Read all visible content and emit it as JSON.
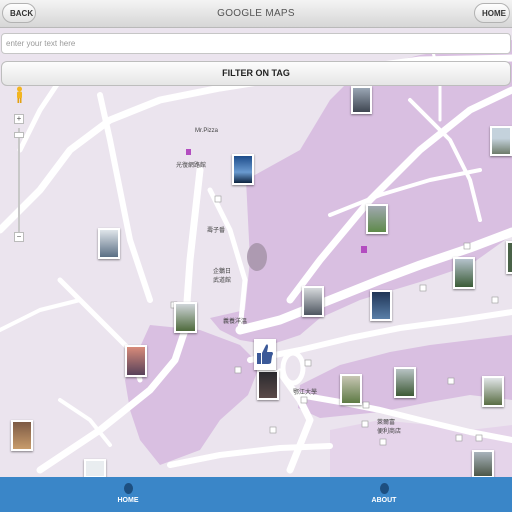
{
  "header": {
    "title": "GOOGLE MAPS",
    "back_label": "BACK",
    "home_label": "HOME"
  },
  "search": {
    "placeholder": "enter your text here",
    "value": ""
  },
  "filter": {
    "label": "FILTER ON TAG"
  },
  "map": {
    "zoom_in": "+",
    "zoom_out": "−",
    "labels": {
      "pizza": "Mr.Pizza",
      "school_road": "光復網路館",
      "brand": "壽子番",
      "sport": "企鵝日",
      "sport2": "武道館",
      "restaurant": "義養洋溫",
      "university": "鄂江大學",
      "store": "萊爾富",
      "store2": "便利商店"
    }
  },
  "tabs": [
    {
      "label": "HOME"
    },
    {
      "label": "ABOUT"
    }
  ],
  "colors": {
    "map_background": "#ebe4ee",
    "campus": "#d9bfe1",
    "road": "#ffffff",
    "bottom_bar": "#3a86c8"
  }
}
